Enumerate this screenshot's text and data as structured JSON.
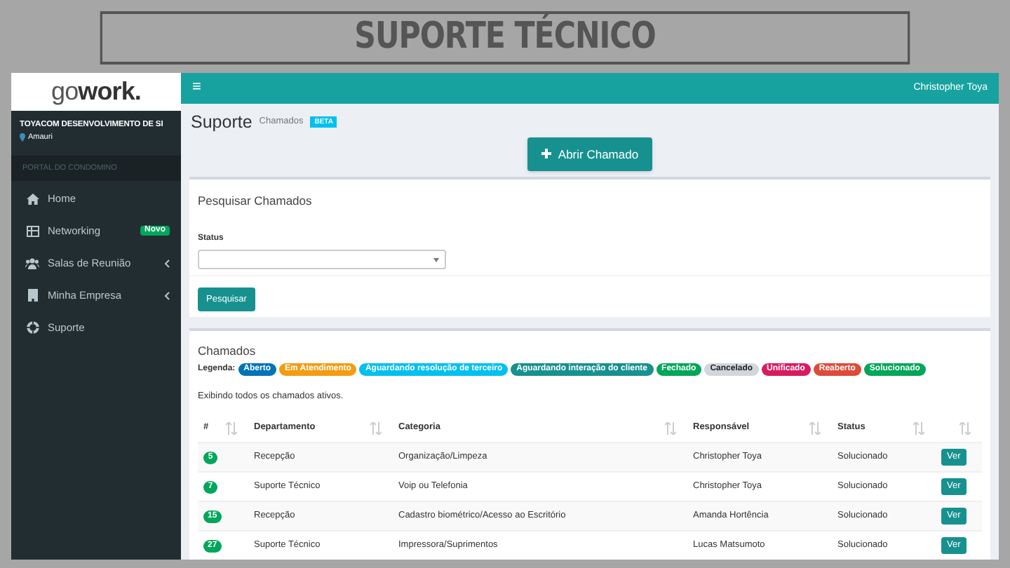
{
  "banner": {
    "title": "SUPORTE TÉCNICO"
  },
  "sidebar": {
    "logo_light": "go",
    "logo_bold": "work.",
    "company": "TOYACOM DESENVOLVIMENTO DE SI",
    "location": "Amauri",
    "section": "PORTAL DO CONDOMINO",
    "items": [
      {
        "label": "Home",
        "caret": false
      },
      {
        "label": "Networking",
        "badge": "Novo",
        "caret": false
      },
      {
        "label": "Salas de Reunião",
        "caret": true
      },
      {
        "label": "Minha Empresa",
        "caret": true
      },
      {
        "label": "Suporte",
        "caret": false
      }
    ]
  },
  "header": {
    "menu_icon": "≡",
    "user": "Christopher Toya"
  },
  "page": {
    "title": "Suporte",
    "subtitle": "Chamados",
    "badge": "BETA",
    "open_button": "Abrir Chamado"
  },
  "search": {
    "title": "Pesquisar Chamados",
    "status_label": "Status",
    "button": "Pesquisar"
  },
  "tickets": {
    "title": "Chamados",
    "legend_label": "Legenda:",
    "legend": [
      {
        "label": "Aberto",
        "color": "#0073b7"
      },
      {
        "label": "Em Atendimento",
        "color": "#f39c12"
      },
      {
        "label": "Aguardando resolução de terceiro",
        "color": "#00c0ef"
      },
      {
        "label": "Aguardando interação do cliente",
        "color": "#17918f"
      },
      {
        "label": "Fechado",
        "color": "#00a65a"
      },
      {
        "label": "Cancelado",
        "color": "#d2d6de"
      },
      {
        "label": "Unificado",
        "color": "#d81b60"
      },
      {
        "label": "Reaberto",
        "color": "#dd4b39"
      },
      {
        "label": "Solucionado",
        "color": "#00a65a"
      }
    ],
    "info": "Exibindo todos os chamados ativos.",
    "columns": [
      "#",
      "Departamento",
      "Categoria",
      "Responsável",
      "Status"
    ],
    "rows": [
      {
        "id": "5",
        "color": "#00a65a",
        "department": "Recepção",
        "category": "Organização/Limpeza",
        "owner": "Christopher Toya",
        "status": "Solucionado",
        "action": "Ver"
      },
      {
        "id": "7",
        "color": "#00a65a",
        "department": "Suporte Técnico",
        "category": "Voip ou Telefonia",
        "owner": "Christopher Toya",
        "status": "Solucionado",
        "action": "Ver"
      },
      {
        "id": "15",
        "color": "#00a65a",
        "department": "Recepção",
        "category": "Cadastro biométrico/Acesso ao Escritório",
        "owner": "Amanda Hortência",
        "status": "Solucionado",
        "action": "Ver"
      },
      {
        "id": "27",
        "color": "#00a65a",
        "department": "Suporte Técnico",
        "category": "Impressora/Suprimentos",
        "owner": "Lucas Matsumoto",
        "status": "Solucionado",
        "action": "Ver"
      }
    ]
  }
}
